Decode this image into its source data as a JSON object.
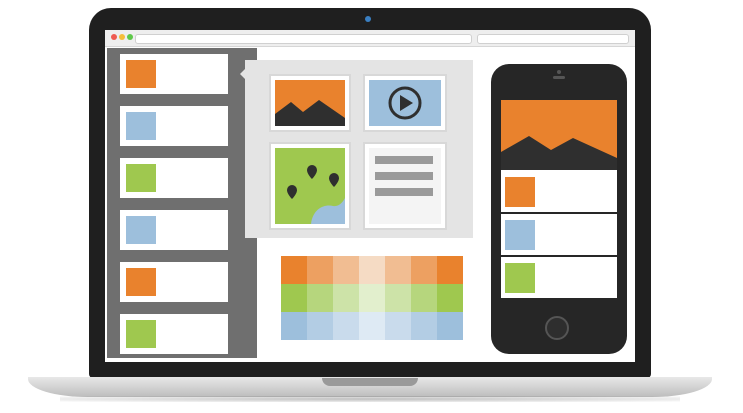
{
  "colors": {
    "orange": "#e9822d",
    "blue": "#9dbfdc",
    "green": "#9fc84f",
    "shell": "#1f1f1f",
    "sidebar": "#6f6f6f",
    "mountain": "#2f2f2f"
  },
  "sidebar": {
    "items": [
      {
        "color": "orange"
      },
      {
        "color": "blue"
      },
      {
        "color": "green"
      },
      {
        "color": "blue"
      },
      {
        "color": "orange"
      },
      {
        "color": "green"
      }
    ]
  },
  "popover": {
    "tiles": [
      {
        "icon": "landscape-image-icon"
      },
      {
        "icon": "video-play-icon"
      },
      {
        "icon": "map-icon"
      },
      {
        "icon": "text-document-icon"
      }
    ]
  },
  "palette": {
    "rows": [
      [
        "#e9822d",
        "#eda061",
        "#f1bd92",
        "#f5dbc4",
        "#f1bd92",
        "#eda061",
        "#e9822d"
      ],
      [
        "#9fc84f",
        "#b6d67d",
        "#cde3a8",
        "#e2efcd",
        "#cde3a8",
        "#b6d67d",
        "#9fc84f"
      ],
      [
        "#9dbfdc",
        "#b3cde4",
        "#c9dbec",
        "#deeaf4",
        "#c9dbec",
        "#b3cde4",
        "#9dbfdc"
      ]
    ]
  },
  "phone": {
    "items": [
      {
        "color": "orange"
      },
      {
        "color": "blue"
      },
      {
        "color": "green"
      }
    ]
  }
}
